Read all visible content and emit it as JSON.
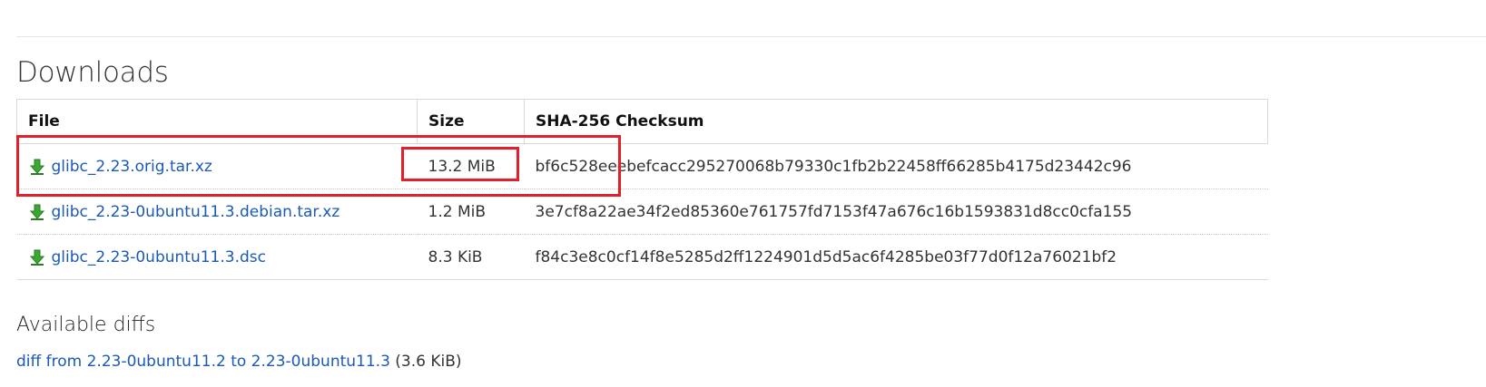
{
  "downloads": {
    "title": "Downloads",
    "headers": {
      "file": "File",
      "size": "Size",
      "checksum": "SHA-256 Checksum"
    },
    "rows": [
      {
        "file": "glibc_2.23.orig.tar.xz",
        "size": "13.2 MiB",
        "checksum": "bf6c528eeebefcacc295270068b79330c1fb2b22458ff66285b4175d23442c96"
      },
      {
        "file": "glibc_2.23-0ubuntu11.3.debian.tar.xz",
        "size": "1.2 MiB",
        "checksum": "3e7cf8a22ae34f2ed85360e761757fd7153f47a676c16b1593831d8cc0cfa155"
      },
      {
        "file": "glibc_2.23-0ubuntu11.3.dsc",
        "size": "8.3 KiB",
        "checksum": "f84c3e8c0cf14f8e5285d2ff1224901d5d5ac6f4285be03f77d0f12a76021bf2"
      }
    ],
    "icon": "download-arrow-icon"
  },
  "diffs": {
    "title": "Available diffs",
    "link_text": "diff from 2.23-0ubuntu11.2 to 2.23-0ubuntu11.3",
    "size": "(3.6 KiB)"
  },
  "colors": {
    "link": "#1a5ab6",
    "highlight": "#e2202c",
    "icon": "#3aa832"
  }
}
